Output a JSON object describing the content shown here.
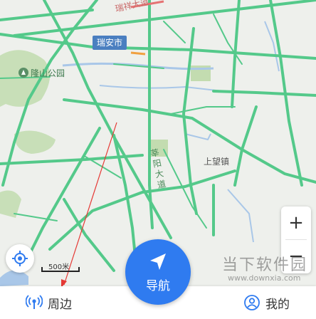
{
  "map": {
    "city_label": "瑞安市",
    "park_label": "隆山公园",
    "town_label": "上望镇",
    "road_label_north": "瑞祥大道",
    "road_label_center": "莘阳大道"
  },
  "map_controls": {
    "zoom_in": "+",
    "zoom_out": "−",
    "scale_label": "500米"
  },
  "bottom_nav": {
    "nearby_label": "周边",
    "navigation_label": "导航",
    "mine_label": "我的"
  },
  "watermark": {
    "title": "当下软件园",
    "url": "www.downxia.com"
  },
  "colors": {
    "road": "#54c98a",
    "nav_button": "#2f7bf0",
    "city_badge": "#4a7fc0",
    "water": "#a9c7e8",
    "park": "#c8dfb8",
    "annotation_arrow": "#e53935"
  }
}
